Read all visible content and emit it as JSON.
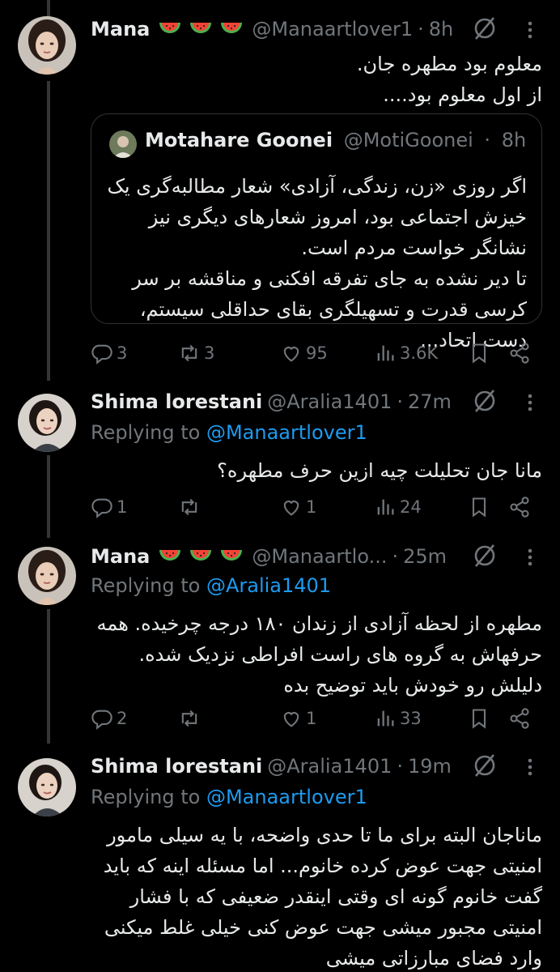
{
  "tweets": [
    {
      "name": "Mana",
      "handle": "@Manaartlover1",
      "time": "8h",
      "text": "معلوم بود مطهره جان.\nاز اول معلوم بود....",
      "quote": {
        "name": "Motahare Goonei",
        "handle": "@MotiGoonei",
        "time": "8h",
        "text": "اگر روزی «زن، زندگی، آزادی» شعار مطالبه‌گری یک خیزش اجتماعی بود، امروز شعارهای دیگری نیز نشانگر خواست مردم است.\nتا دیر نشده به جای تفرقه افکنی و مناقشه بر سر کرسی قدرت و تسهیلگری بقای حداقلی سیستم، دست اتحاد..."
      },
      "replies": "3",
      "retweets": "3",
      "likes": "95",
      "views": "3.6K"
    },
    {
      "name": "Shima lorestani",
      "handle": "@Aralia1401",
      "time": "27m",
      "replying_prefix": "Replying to",
      "replying_to": "@Manaartlover1",
      "text": "مانا جان تحلیلت چیه ازین حرف مطهره؟",
      "replies": "1",
      "retweets": "",
      "likes": "1",
      "views": "24"
    },
    {
      "name": "Mana",
      "handle": "@Manaartlo...",
      "time": "25m",
      "replying_prefix": "Replying to",
      "replying_to": "@Aralia1401",
      "text": "مطهره از لحظه آزادی از زندان ۱۸۰ درجه چرخیده. همه حرفهاش به گروه های راست افراطی نزدیک شده. دلیلش رو خودش باید توضیح بده",
      "replies": "2",
      "retweets": "",
      "likes": "1",
      "views": "33"
    },
    {
      "name": "Shima lorestani",
      "handle": "@Aralia1401",
      "time": "19m",
      "replying_prefix": "Replying to",
      "replying_to": "@Manaartlover1",
      "text": "ماناجان البته برای ما تا حدی واضحه، با یه سیلی مامور امنیتی جهت عوض کرده خانوم... اما مسئله اینه که باید گفت خانوم گونه ای وقتی اینقدر ضعیفی که با فشار امنیتی مجبور میشی جهت عوض کنی خیلی غلط میکنی وارد فضای مبارزاتی میشی"
    }
  ],
  "colors": {
    "background": "#000000",
    "text": "#e7e9ea",
    "muted": "#71767b",
    "accent": "#1d9bf0",
    "border": "#2f3336"
  },
  "icons": [
    "reply-icon",
    "retweet-icon",
    "like-icon",
    "views-icon",
    "bookmark-icon",
    "share-icon",
    "grok-icon",
    "more-icon",
    "watermelon-emoji"
  ]
}
